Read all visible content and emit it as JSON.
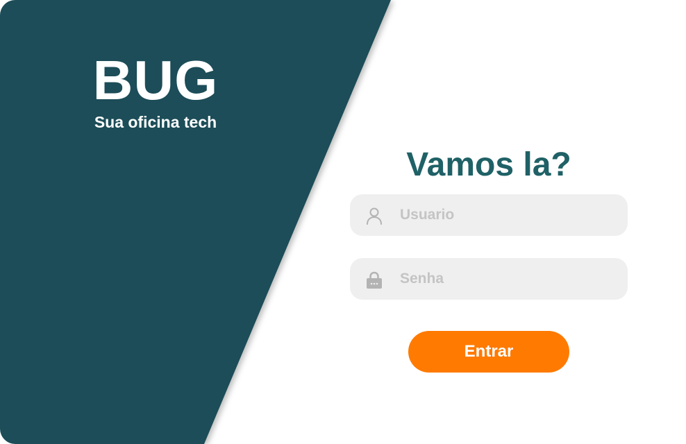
{
  "brand": {
    "title": "BUG",
    "subtitle": "Sua oficina tech"
  },
  "login": {
    "title": "Vamos la?",
    "username": {
      "placeholder": "Usuario",
      "value": "",
      "icon": "user-icon"
    },
    "password": {
      "placeholder": "Senha",
      "value": "",
      "icon": "lock-icon"
    },
    "submit_label": "Entrar"
  },
  "colors": {
    "panel": "#1d4e59",
    "title": "#1f6166",
    "accent": "#ff7a00",
    "field_bg": "#efefef",
    "placeholder": "#c4c4c4"
  }
}
